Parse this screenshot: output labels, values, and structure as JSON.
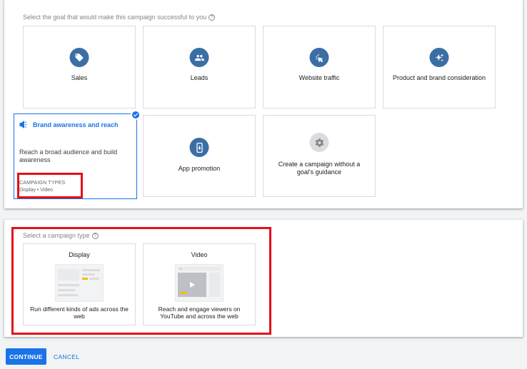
{
  "goal_section": {
    "title": "Select the goal that would make this campaign successful to you",
    "goals": [
      {
        "label": "Sales",
        "icon": "tag-icon"
      },
      {
        "label": "Leads",
        "icon": "people-icon"
      },
      {
        "label": "Website traffic",
        "icon": "cursor-click-icon"
      },
      {
        "label": "Product and brand consideration",
        "icon": "sparkle-icon"
      },
      {
        "label": "App promotion",
        "icon": "phone-icon"
      },
      {
        "label": "Create a campaign without a goal's guidance",
        "icon": "gear-icon"
      }
    ],
    "selected": {
      "title": "Brand awareness and reach",
      "description": "Reach a broad audience and build awareness",
      "types_label": "CAMPAIGN TYPES",
      "types_value": "Display • Video"
    }
  },
  "type_section": {
    "title": "Select a campaign type",
    "types": [
      {
        "title": "Display",
        "description": "Run different kinds of ads across the web"
      },
      {
        "title": "Video",
        "description": "Reach and engage viewers on YouTube and across the web"
      }
    ]
  },
  "actions": {
    "continue_label": "CONTINUE",
    "cancel_label": "CANCEL"
  },
  "colors": {
    "accent": "#1a73e8",
    "icon_bg": "#3b6ea5",
    "highlight": "#e3101b"
  }
}
